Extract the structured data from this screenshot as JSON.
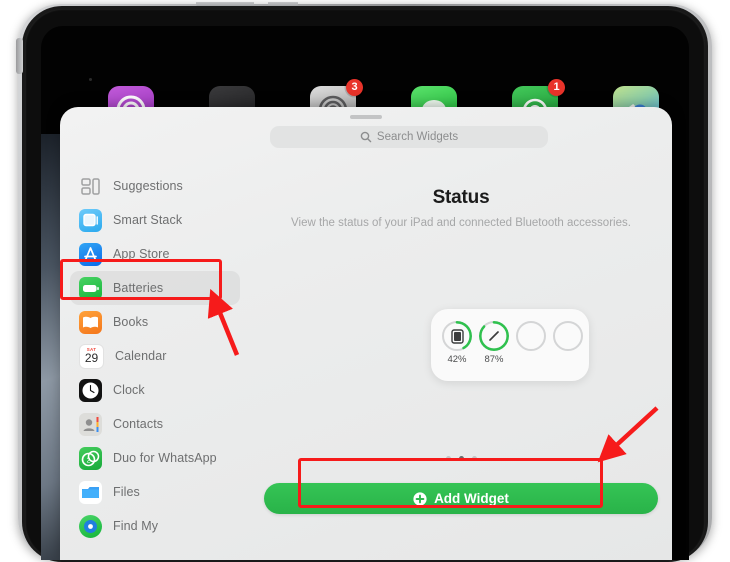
{
  "device": {
    "name": "iPad",
    "orientation": "landscape"
  },
  "home_screen": {
    "apps": [
      {
        "name": "Podcasts",
        "color": "#a martin",
        "badge": null
      },
      {
        "name": "Apple TV",
        "badge": null
      },
      {
        "name": "Settings",
        "badge": "3"
      },
      {
        "name": "Messages",
        "badge": null
      },
      {
        "name": "WhatsApp",
        "badge": "1"
      },
      {
        "name": "Maps",
        "badge": null
      }
    ]
  },
  "sheet": {
    "grabber": "drag-handle",
    "search": {
      "placeholder": "Search Widgets",
      "value": "",
      "icon": "search-icon"
    },
    "sidebar": {
      "items": [
        {
          "label": "Suggestions",
          "icon": "suggestions-icon",
          "selected": false
        },
        {
          "label": "Smart Stack",
          "icon": "smart-stack-icon",
          "selected": false
        },
        {
          "label": "App Store",
          "icon": "app-store-icon",
          "selected": false
        },
        {
          "label": "Batteries",
          "icon": "batteries-icon",
          "selected": true
        },
        {
          "label": "Books",
          "icon": "books-icon",
          "selected": false
        },
        {
          "label": "Calendar",
          "icon": "calendar-icon",
          "selected": false
        },
        {
          "label": "Clock",
          "icon": "clock-icon",
          "selected": false
        },
        {
          "label": "Contacts",
          "icon": "contacts-icon",
          "selected": false
        },
        {
          "label": "Duo for WhatsApp",
          "icon": "duo-icon",
          "selected": false
        },
        {
          "label": "Files",
          "icon": "files-icon",
          "selected": false
        },
        {
          "label": "Find My",
          "icon": "find-my-icon",
          "selected": false
        }
      ],
      "calendar_icon_day": "29",
      "calendar_icon_weekday": "SAT"
    },
    "detail": {
      "title": "Status",
      "subtitle": "View the status of your iPad and connected Bluetooth accessories.",
      "widget_preview": {
        "name": "Batteries Status widget",
        "rings": [
          {
            "label": "42%",
            "percent": 42,
            "glyph": "ipad-glyph",
            "filled": true
          },
          {
            "label": "87%",
            "percent": 87,
            "glyph": "pencil-glyph",
            "filled": true
          },
          {
            "label": "",
            "percent": 0,
            "glyph": "",
            "filled": false
          },
          {
            "label": "",
            "percent": 0,
            "glyph": "",
            "filled": false
          }
        ]
      },
      "page_dots": {
        "count": 3,
        "active_index": 1
      },
      "add_button": {
        "label": "Add Widget",
        "icon": "plus-circle-icon",
        "color": "#2fb94f"
      }
    }
  },
  "annotations": {
    "highlight_boxes": [
      {
        "target": "Batteries sidebar item",
        "color": "#f61b1b"
      },
      {
        "target": "Add Widget button",
        "color": "#f61b1b"
      }
    ],
    "arrows": [
      {
        "points_to": "Batteries sidebar item",
        "color": "#f61b1b"
      },
      {
        "points_to": "Add Widget button",
        "color": "#f61b1b"
      }
    ]
  }
}
